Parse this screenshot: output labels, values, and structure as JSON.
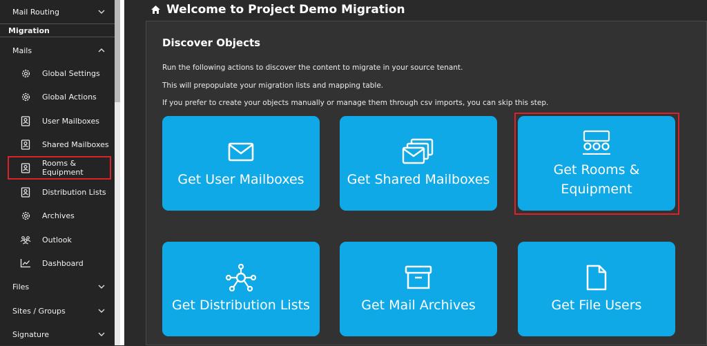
{
  "sidebar": {
    "mail_routing": "Mail Routing",
    "section": "Migration",
    "mails": "Mails",
    "items": [
      {
        "label": "Global Settings",
        "icon": "gear-icon"
      },
      {
        "label": "Global Actions",
        "icon": "gear-icon"
      },
      {
        "label": "User Mailboxes",
        "icon": "mailbox-icon"
      },
      {
        "label": "Shared Mailboxes",
        "icon": "mailbox-icon"
      },
      {
        "label": "Rooms & Equipment",
        "icon": "mailbox-icon"
      },
      {
        "label": "Distribution Lists",
        "icon": "mailbox-icon"
      },
      {
        "label": "Archives",
        "icon": "gear-icon"
      },
      {
        "label": "Outlook",
        "icon": "people-icon"
      },
      {
        "label": "Dashboard",
        "icon": "chart-icon"
      }
    ],
    "files": "Files",
    "sites_groups": "Sites / Groups",
    "signature": "Signature"
  },
  "header": {
    "title": "Welcome to Project Demo Migration"
  },
  "panel": {
    "title": "Discover Objects",
    "desc1": "Run the following actions to discover the content to migrate in your source tenant.",
    "desc2": "This will prepopulate your migration lists and mapping table.",
    "desc3": "If you prefer to create your objects manually or manage them through csv imports, you can skip this step."
  },
  "tiles": {
    "user_mailboxes": {
      "line1": "Get User Mailboxes"
    },
    "shared_mailboxes": {
      "line1": "Get Shared Mailboxes"
    },
    "rooms": {
      "line1": "Get Rooms &",
      "line2": "Equipment"
    },
    "distribution": {
      "line1": "Get Distribution Lists"
    },
    "archives": {
      "line1": "Get Mail Archives"
    },
    "file_users": {
      "line1": "Get File Users"
    }
  },
  "colors": {
    "tile": "#0ea9e6",
    "highlight": "#d8232a",
    "background": "#2a2a2a"
  }
}
